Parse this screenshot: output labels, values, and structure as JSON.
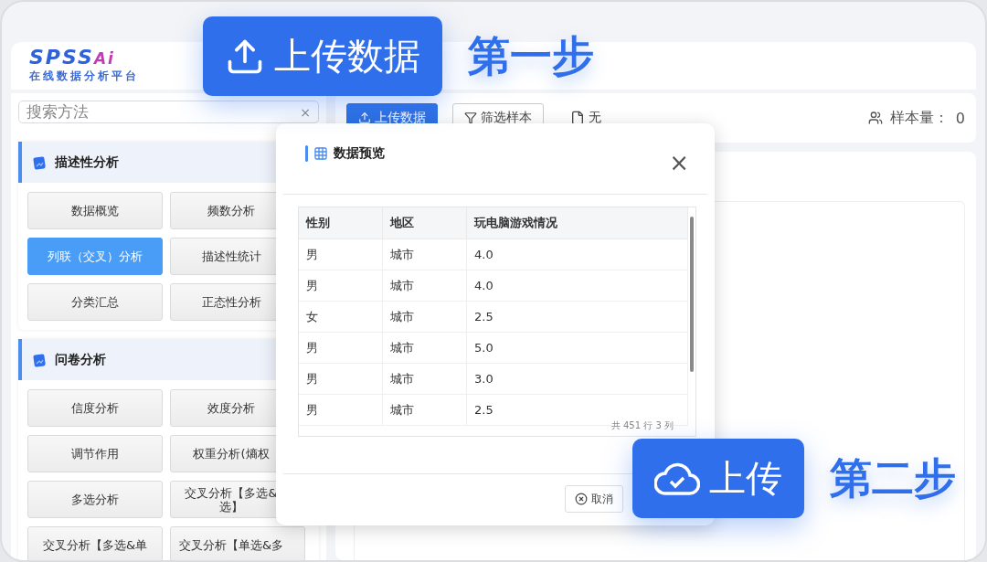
{
  "logo": {
    "name": "SPSS",
    "suffix": "Ai",
    "tagline": "在线数据分析平台"
  },
  "sidebar": {
    "search": {
      "placeholder": "搜索方法",
      "clear": "×"
    },
    "sections": [
      {
        "title": "描述性分析",
        "items": [
          {
            "label": "数据概览",
            "selected": false
          },
          {
            "label": "频数分析",
            "selected": false
          },
          {
            "label": "列联（交叉）分析",
            "selected": true
          },
          {
            "label": "描述性统计",
            "selected": false
          },
          {
            "label": "分类汇总",
            "selected": false
          },
          {
            "label": "正态性分析",
            "selected": false
          }
        ]
      },
      {
        "title": "问卷分析",
        "items": [
          {
            "label": "信度分析",
            "selected": false
          },
          {
            "label": "效度分析",
            "selected": false
          },
          {
            "label": "调节作用",
            "selected": false
          },
          {
            "label": "权重分析(熵权",
            "selected": false
          },
          {
            "label": "多选分析",
            "selected": false
          },
          {
            "label": "交叉分析【多选&\n选】",
            "selected": false
          },
          {
            "label": "交叉分析【多选&单",
            "selected": false
          },
          {
            "label": "交叉分析【单选&多",
            "selected": false
          }
        ]
      }
    ]
  },
  "toolbar": {
    "buttons": [
      {
        "label": "上传数据",
        "kind": "primary"
      },
      {
        "label": "筛选样本",
        "kind": "filter"
      },
      {
        "label": "无",
        "kind": "file"
      }
    ],
    "sample_label": "样本量：",
    "sample_count": "0"
  },
  "dialog": {
    "title": "数据预览",
    "close": "×",
    "table": {
      "columns": [
        "性别",
        "地区",
        "玩电脑游戏情况"
      ],
      "rows": [
        [
          "男",
          "城市",
          "4.0"
        ],
        [
          "男",
          "城市",
          "4.0"
        ],
        [
          "女",
          "城市",
          "2.5"
        ],
        [
          "男",
          "城市",
          "5.0"
        ],
        [
          "男",
          "城市",
          "3.0"
        ],
        [
          "男",
          "城市",
          "2.5"
        ]
      ]
    },
    "summary": "共 451 行 3 列",
    "buttons": [
      {
        "label": "取消"
      }
    ]
  },
  "callouts": [
    {
      "kind": "upload",
      "label": "上传数据",
      "step": "第一步"
    },
    {
      "kind": "cloud",
      "label": "上传",
      "step": "第二步"
    }
  ]
}
